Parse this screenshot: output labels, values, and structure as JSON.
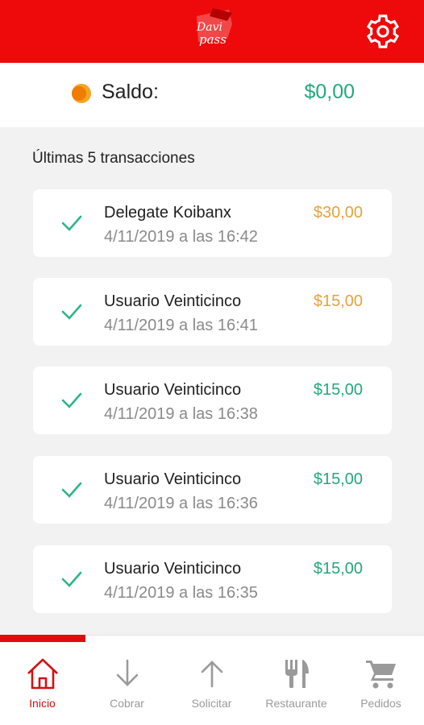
{
  "header": {
    "logo_icon": "davipass-logo",
    "settings_icon": "gear-icon"
  },
  "balance": {
    "label": "Saldo:",
    "value": "$0,00",
    "coin_color": "#f39c12"
  },
  "transactions_title": "Últimas 5 transacciones",
  "transactions": [
    {
      "name": "Delegate Koibanx",
      "date": "4/11/2019 a las 16:42",
      "amount": "$30,00",
      "amount_color": "#e6a23c"
    },
    {
      "name": "Usuario Veinticinco",
      "date": "4/11/2019 a las 16:41",
      "amount": "$15,00",
      "amount_color": "#e6a23c"
    },
    {
      "name": "Usuario Veinticinco",
      "date": "4/11/2019 a las 16:38",
      "amount": "$15,00",
      "amount_color": "#23a87a"
    },
    {
      "name": "Usuario Veinticinco",
      "date": "4/11/2019 a las 16:36",
      "amount": "$15,00",
      "amount_color": "#23a87a"
    },
    {
      "name": "Usuario Veinticinco",
      "date": "4/11/2019 a las 16:35",
      "amount": "$15,00",
      "amount_color": "#23a87a"
    }
  ],
  "nav": {
    "items": [
      {
        "label": "Inicio",
        "icon": "home-icon",
        "active": true
      },
      {
        "label": "Cobrar",
        "icon": "arrow-down-icon",
        "active": false
      },
      {
        "label": "Solicitar",
        "icon": "arrow-up-icon",
        "active": false
      },
      {
        "label": "Restaurante",
        "icon": "fork-knife-icon",
        "active": false
      },
      {
        "label": "Pedidos",
        "icon": "cart-icon",
        "active": false
      }
    ]
  },
  "colors": {
    "brand_red": "#ee0a0a",
    "positive_green": "#23a87a",
    "pending_orange": "#e6a23c",
    "check_green": "#2bb58a"
  }
}
